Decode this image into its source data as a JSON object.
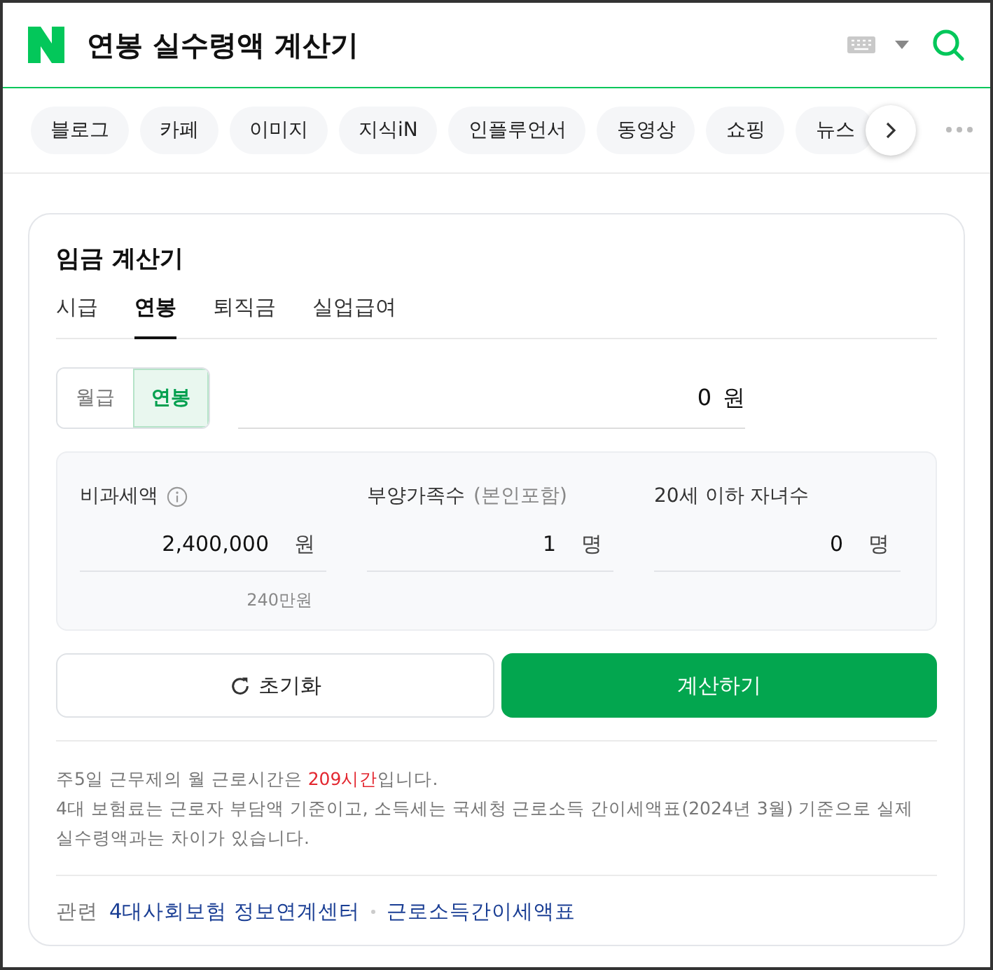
{
  "header": {
    "title": "연봉 실수령액 계산기"
  },
  "categories": [
    {
      "label": "블로그"
    },
    {
      "label": "카페"
    },
    {
      "label": "이미지"
    },
    {
      "label": "지식iN"
    },
    {
      "label": "인플루언서"
    },
    {
      "label": "동영상"
    },
    {
      "label": "쇼핑"
    },
    {
      "label": "뉴스"
    }
  ],
  "calculator": {
    "title": "임금 계산기",
    "tabs": [
      {
        "label": "시급",
        "selected": false
      },
      {
        "label": "연봉",
        "selected": true
      },
      {
        "label": "퇴직금",
        "selected": false
      },
      {
        "label": "실업급여",
        "selected": false
      }
    ],
    "pay_type": [
      {
        "label": "월급",
        "selected": false
      },
      {
        "label": "연봉",
        "selected": true
      }
    ],
    "salary": {
      "value": "0",
      "unit": "원"
    },
    "fields": [
      {
        "label": "비과세액",
        "info": true,
        "value": "2,400,000",
        "unit": "원",
        "sub": "240만원"
      },
      {
        "label": "부양가족수",
        "hint": "(본인포함)",
        "info": false,
        "value": "1",
        "unit": "명"
      },
      {
        "label": "20세 이하 자녀수",
        "info": false,
        "value": "0",
        "unit": "명"
      }
    ],
    "buttons": {
      "reset": "초기화",
      "calculate": "계산하기"
    },
    "notes": [
      {
        "before": "주5일 근무제의 월 근로시간은 ",
        "highlight": "209시간",
        "after": "입니다."
      },
      {
        "before": "4대 보험료는 근로자 부담액 기준이고, 소득세는 국세청 근로소득 간이세액표(2024년 3월) 기준으로 실제 실수령액과는 차이가 있습니다."
      }
    ],
    "related": {
      "label": "관련",
      "links": [
        "4대사회보험 정보연계센터",
        "근로소득간이세액표"
      ]
    }
  }
}
